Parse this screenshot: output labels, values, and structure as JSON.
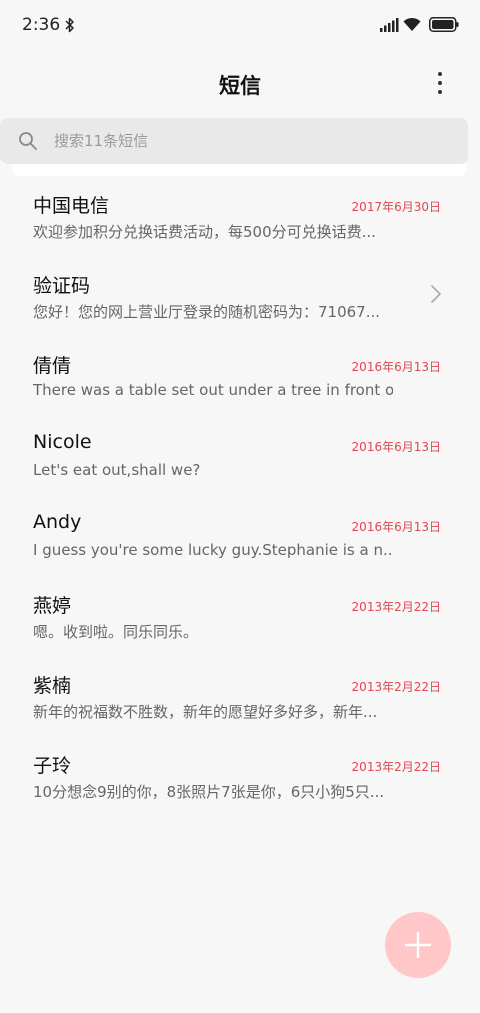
{
  "status_bar": {
    "time": "2:36",
    "icons": [
      "bluetooth-icon",
      "signal-icon",
      "wifi-icon",
      "battery-icon"
    ]
  },
  "header": {
    "title": "短信",
    "more_icon": "more-vertical-icon"
  },
  "search": {
    "placeholder": "搜索11条短信",
    "value": "",
    "icon": "search-icon"
  },
  "messages": [
    {
      "name": "中国电信",
      "date": "2017年6月30日",
      "preview": "欢迎参加积分兑换话费活动，每500分可兑换话费..."
    },
    {
      "name": "验证码",
      "date": "",
      "preview": "您好！您的网上营业厅登录的随机密码为：71067...",
      "icon": "chevron-right-icon"
    },
    {
      "name": "倩倩",
      "date": "2016年6月13日",
      "preview": "There was a table set out under a tree in front o..."
    },
    {
      "name": "Nicole",
      "date": "2016年6月13日",
      "preview": "Let's eat out,shall we?"
    },
    {
      "name": "Andy",
      "date": "2016年6月13日",
      "preview": "I guess you're some lucky guy.Stephanie is a n..."
    },
    {
      "name": "燕婷",
      "date": "2013年2月22日",
      "preview": "嗯。收到啦。同乐同乐。"
    },
    {
      "name": "紫楠",
      "date": "2013年2月22日",
      "preview": "新年的祝福数不胜数，新年的愿望好多好多，新年..."
    },
    {
      "name": "子玲",
      "date": "2013年2月22日",
      "preview": "10分想念9别的你，8张照片7张是你，6只小狗5只..."
    }
  ],
  "fab": {
    "icon": "plus-icon"
  },
  "colors": {
    "background": "#f7f7f7",
    "date": "#e0484e",
    "fab": "#ffc7c8",
    "search_bg": "#e9e9e9"
  }
}
